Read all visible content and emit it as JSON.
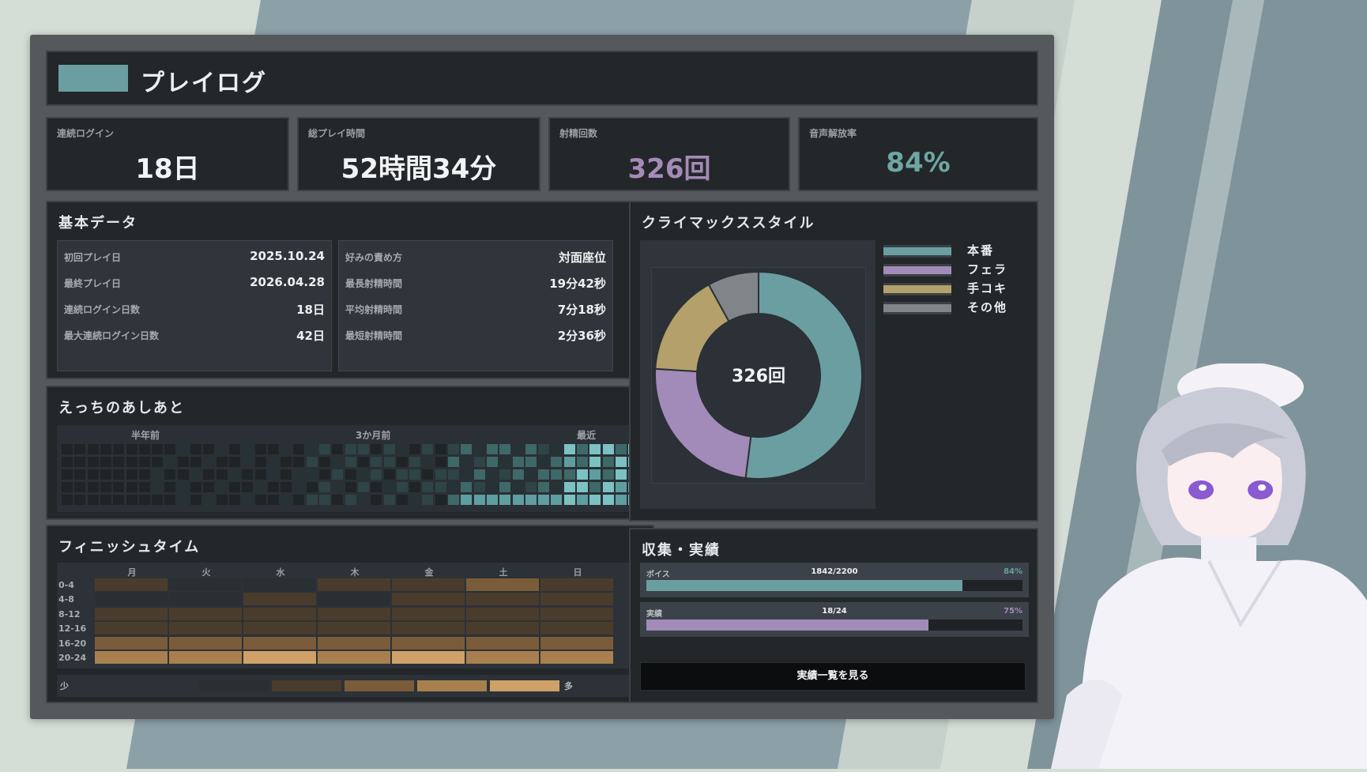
{
  "header": {
    "title": "プレイログ"
  },
  "stats": [
    {
      "label": "連続ログイン",
      "value": "18日",
      "color": "#f1f3f4"
    },
    {
      "label": "総プレイ時間",
      "value": "52時間34分",
      "color": "#f1f3f4"
    },
    {
      "label": "射精回数",
      "value": "326回",
      "color": "#a58ab8"
    },
    {
      "label": "音声解放率",
      "value": "84%",
      "color": "#6ea6a4"
    }
  ],
  "basic": {
    "title": "基本データ",
    "left": [
      {
        "key": "初回プレイ日",
        "value": "2025.10.24"
      },
      {
        "key": "最終プレイ日",
        "value": "2026.04.28"
      },
      {
        "key": "連続ログイン日数",
        "value": "18日"
      },
      {
        "key": "最大連続ログイン日数",
        "value": "42日"
      }
    ],
    "right": [
      {
        "key": "好みの責め方",
        "value": "対面座位"
      },
      {
        "key": "最長射精時間",
        "value": "19分42秒"
      },
      {
        "key": "平均射精時間",
        "value": "7分18秒"
      },
      {
        "key": "最短射精時間",
        "value": "2分36秒"
      }
    ]
  },
  "heatmap": {
    "title": "えっちのあしあと",
    "labels": [
      "半年前",
      "3か月前",
      "最近"
    ]
  },
  "finish": {
    "title": "フィニッシュタイム",
    "days": [
      "月",
      "火",
      "水",
      "木",
      "金",
      "土",
      "日"
    ],
    "hours": [
      "0-4",
      "4-8",
      "8-12",
      "12-16",
      "16-20",
      "20-24"
    ],
    "levels": [
      [
        2,
        1,
        1,
        2,
        2,
        3,
        2
      ],
      [
        1,
        1,
        2,
        1,
        2,
        2,
        2
      ],
      [
        2,
        2,
        2,
        2,
        2,
        2,
        2
      ],
      [
        2,
        2,
        2,
        2,
        2,
        2,
        2
      ],
      [
        3,
        3,
        3,
        3,
        3,
        3,
        3
      ],
      [
        4,
        4,
        5,
        4,
        5,
        4,
        4
      ]
    ],
    "legend_low": "少",
    "legend_high": "多"
  },
  "climax": {
    "title": "クライマックススタイル",
    "center_label": "326回",
    "legend": [
      {
        "name": "本番",
        "color": "#6b9ea0"
      },
      {
        "name": "フェラ",
        "color": "#a28bb8"
      },
      {
        "name": "手コキ",
        "color": "#b3a06a"
      },
      {
        "name": "その他",
        "color": "#80858a"
      }
    ]
  },
  "chart_data": {
    "type": "pie",
    "labels": [
      "本番",
      "フェラ",
      "手コキ",
      "その他"
    ],
    "values": [
      52,
      24,
      16,
      8
    ],
    "total_label": "326回"
  },
  "collect": {
    "title": "収集・実績",
    "bars": [
      {
        "label": "ボイス",
        "count": "1842/2200",
        "percent": "84%",
        "fraction": 0.84,
        "color": "#6b9ea0"
      },
      {
        "label": "実績",
        "count": "18/24",
        "percent": "75%",
        "fraction": 0.75,
        "color": "#a28bb8"
      }
    ],
    "button": "実績一覧を見る"
  }
}
